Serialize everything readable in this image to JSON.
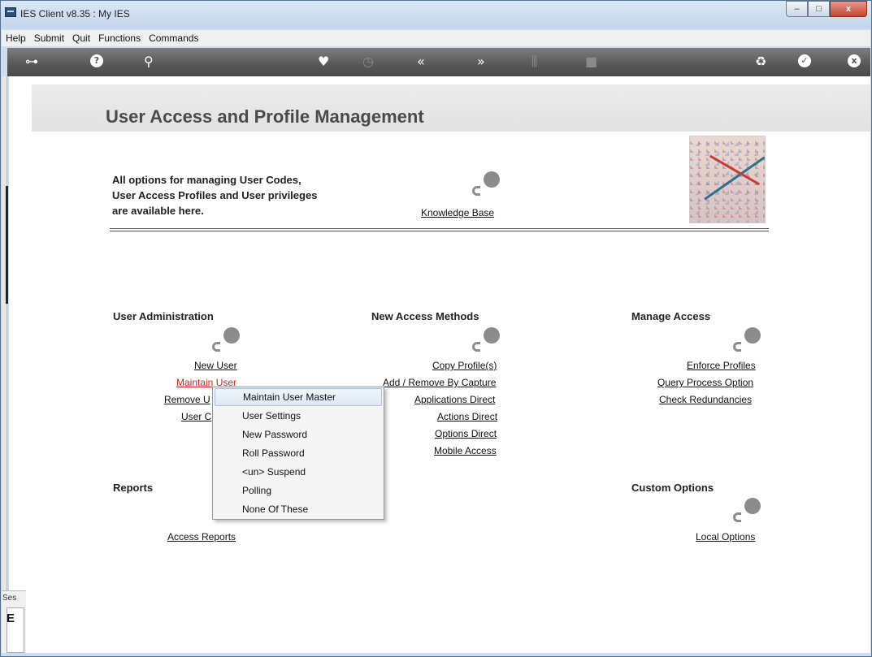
{
  "window": {
    "title": "IES Client v8.35 : My IES",
    "controls": [
      "–",
      "□",
      "x"
    ]
  },
  "menubar": {
    "items": [
      "Help",
      "Submit",
      "Quit",
      "Functions",
      "Commands"
    ]
  },
  "toolbar": {
    "icons": [
      {
        "name": "key-icon",
        "glyph": "⊶"
      },
      {
        "name": "help-icon",
        "glyph": "?"
      },
      {
        "name": "search-icon",
        "glyph": "⚲"
      },
      {
        "name": "heart-icon",
        "glyph": "♥"
      },
      {
        "name": "clock-icon",
        "glyph": "◷"
      },
      {
        "name": "back-icon",
        "glyph": "«"
      },
      {
        "name": "forward-icon",
        "glyph": "»"
      },
      {
        "name": "tools-icon",
        "glyph": "⫼"
      },
      {
        "name": "stop-icon",
        "glyph": "■"
      },
      {
        "name": "recycle-icon",
        "glyph": "♻"
      },
      {
        "name": "check-icon",
        "glyph": "✓"
      },
      {
        "name": "close-icon",
        "glyph": "x"
      }
    ]
  },
  "page": {
    "title": "User Access and Profile Management",
    "intro": [
      "All options for managing User Codes,",
      "User Access Profiles and User privileges",
      "are available here."
    ],
    "knowledge_base": "Knowledge Base"
  },
  "sections": {
    "user_admin": {
      "title": "User Administration",
      "links": [
        "New User",
        "Maintain User",
        "Remove U",
        "User C"
      ]
    },
    "new_access": {
      "title": "New Access Methods",
      "links": [
        "Copy Profile(s)",
        "Add / Remove By Capture",
        "Applications Direct",
        "Actions Direct",
        "Options Direct",
        "Mobile Access"
      ]
    },
    "manage_access": {
      "title": "Manage Access",
      "links": [
        "Enforce Profiles",
        "Query Process Option",
        "Check Redundancies"
      ]
    },
    "reports": {
      "title": "Reports",
      "links": [
        "Access Reports"
      ]
    },
    "custom": {
      "title": "Custom Options",
      "links": [
        "Local Options"
      ]
    }
  },
  "context_menu": {
    "items": [
      "Maintain User Master",
      "User Settings",
      "New Password",
      "Roll Password",
      "<un> Suspend",
      "Polling",
      "None Of These"
    ],
    "highlighted": "Maintain User Master"
  },
  "session": {
    "label": "Ses",
    "glyph": "E"
  },
  "colors": {
    "accent_red": "#d92020",
    "toolbar": "#575757",
    "header_band": "#e6e6e6"
  }
}
